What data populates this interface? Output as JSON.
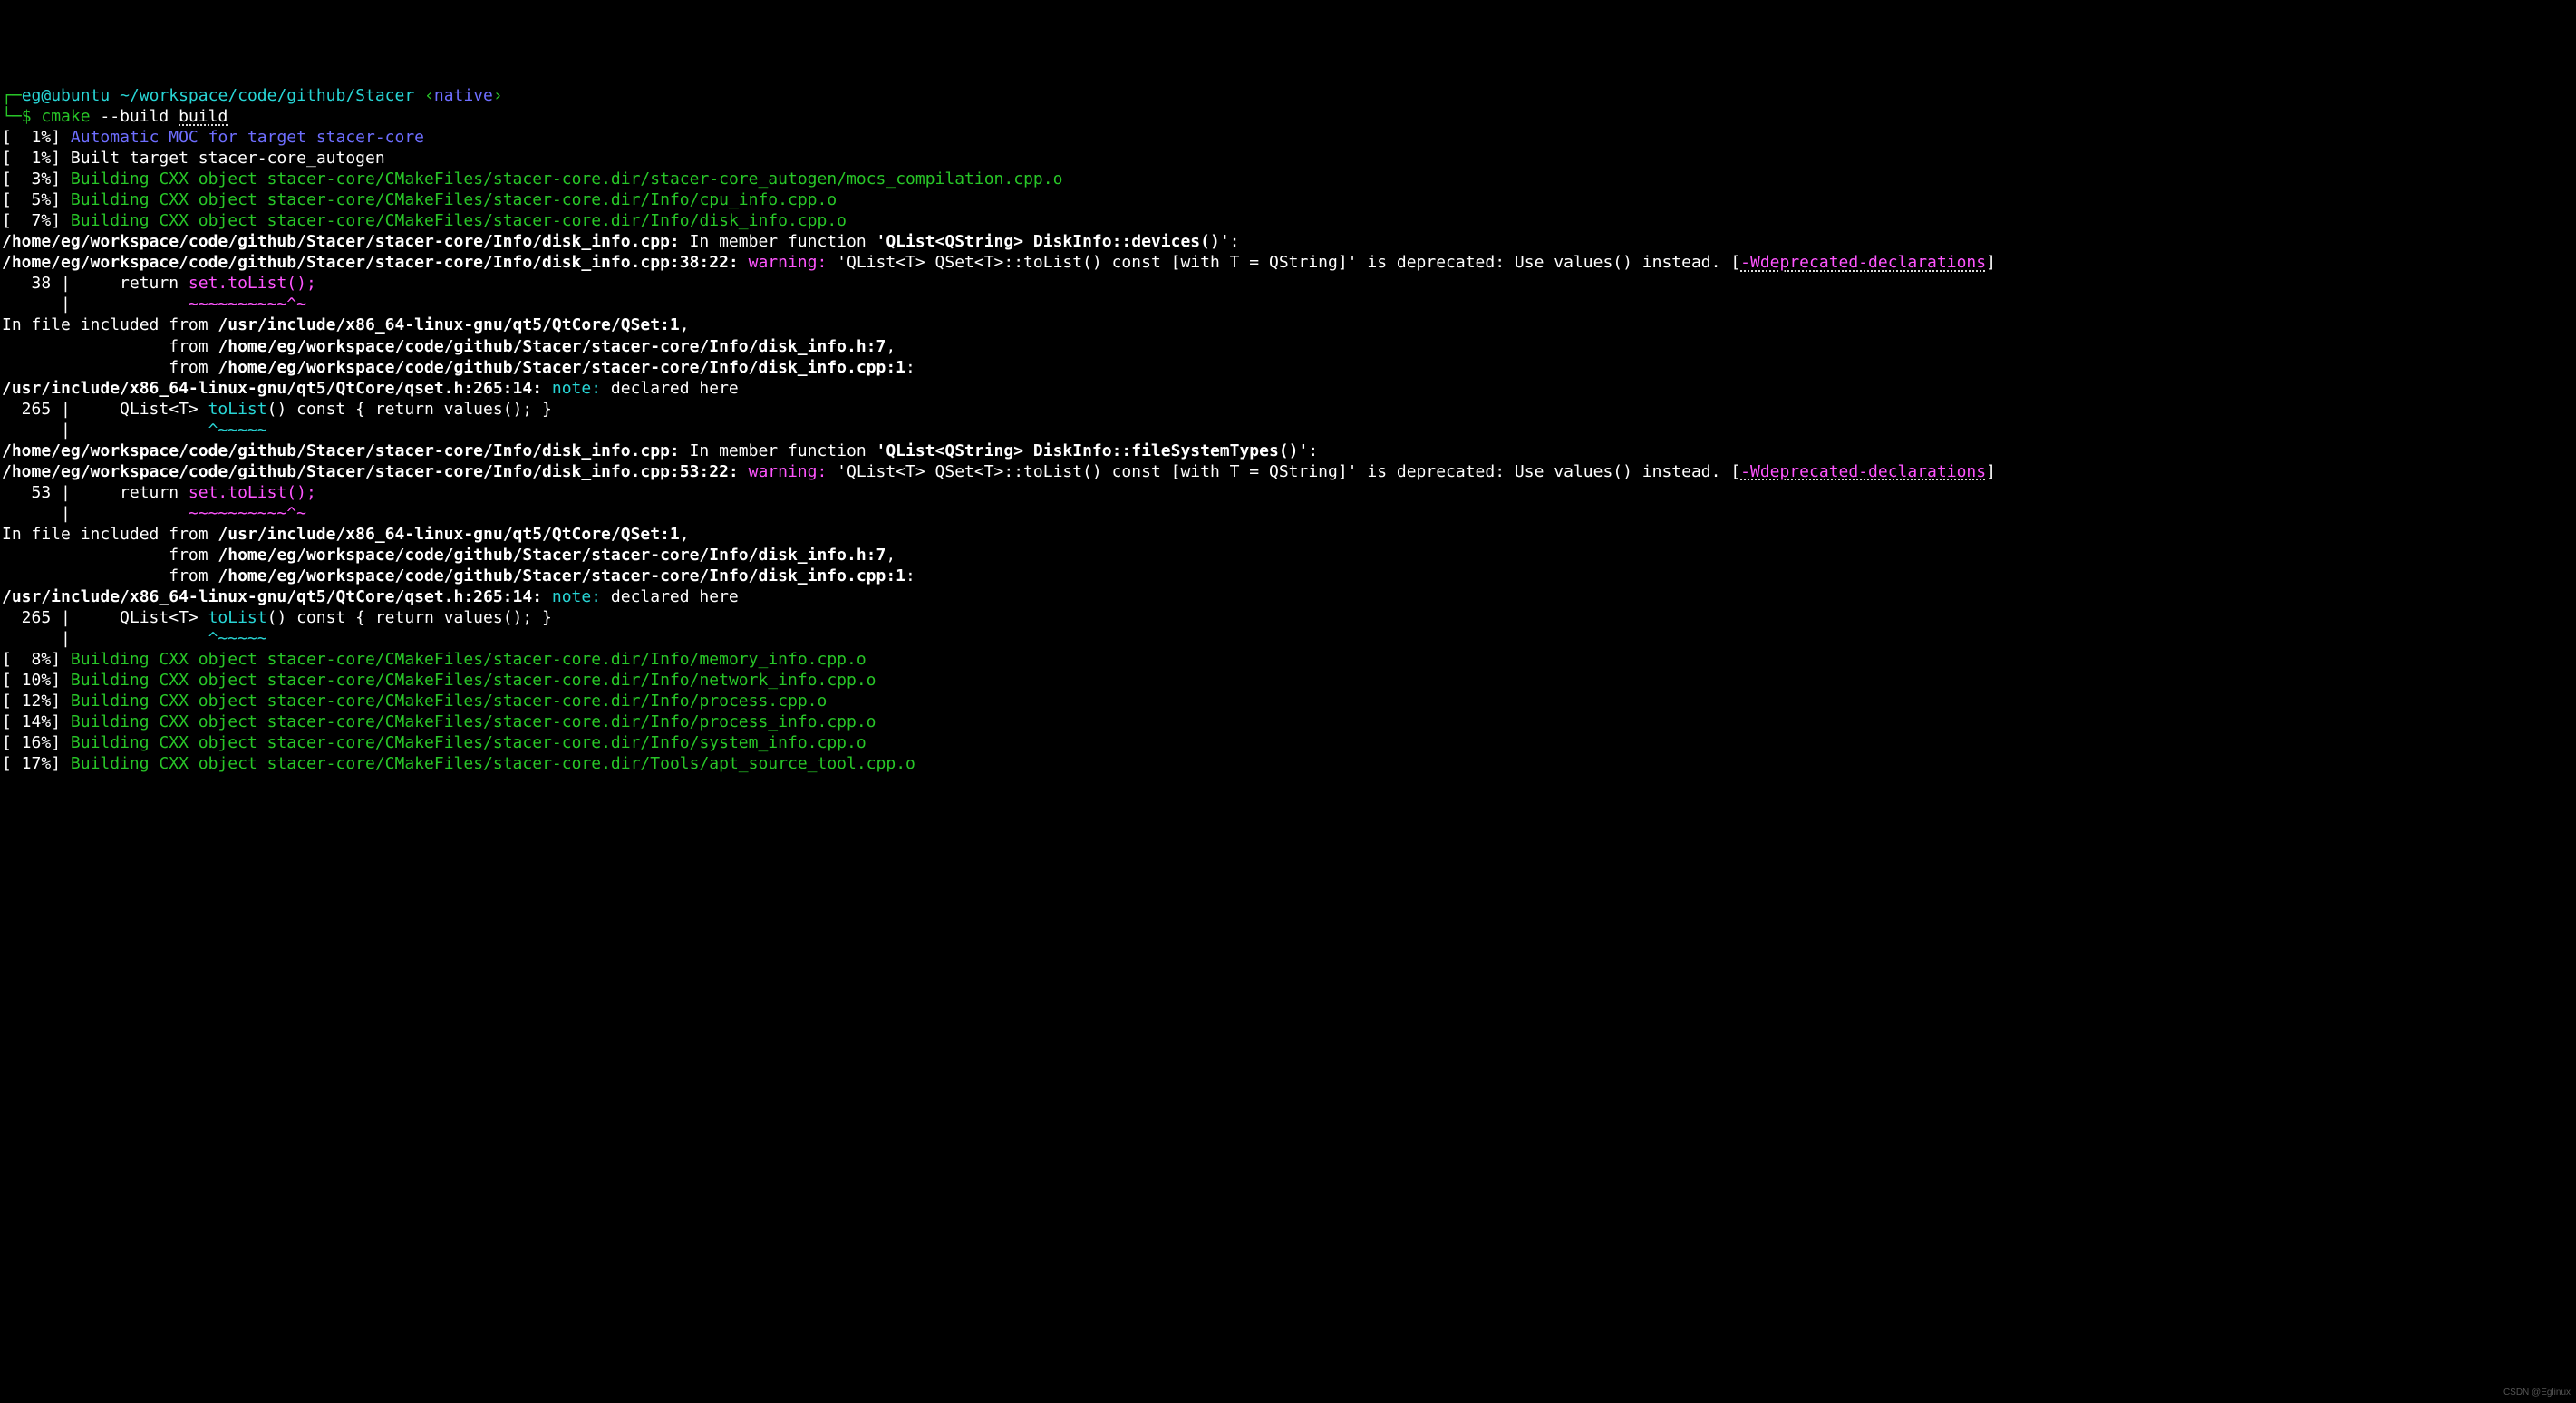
{
  "prompt": {
    "corner_tl": "┌─",
    "user": "eg@ubuntu",
    "path": "~/workspace/code/github/Stacer",
    "tag_open": "‹",
    "tag": "native",
    "tag_close": "›",
    "corner_bl": "└─",
    "dollar": "$",
    "cmd_bin": "cmake",
    "cmd_flag": "--build",
    "cmd_arg": "build"
  },
  "pct_open": "[",
  "pct_close": "]",
  "lines": {
    "l01": {
      "pct": "  1%",
      "automoc": "Automatic MOC for target stacer-core"
    },
    "l01b": {
      "pct": "  1%",
      "text": "Built target stacer-core_autogen"
    },
    "l03": {
      "pct": "  3%",
      "build": "Building CXX object stacer-core/CMakeFiles/stacer-core.dir/stacer-core_autogen/mocs_compilation.cpp.o"
    },
    "l05": {
      "pct": "  5%",
      "build": "Building CXX object stacer-core/CMakeFiles/stacer-core.dir/Info/cpu_info.cpp.o"
    },
    "l07": {
      "pct": "  7%",
      "build": "Building CXX object stacer-core/CMakeFiles/stacer-core.dir/Info/disk_info.cpp.o"
    },
    "l08": {
      "pct": "  8%",
      "build": "Building CXX object stacer-core/CMakeFiles/stacer-core.dir/Info/memory_info.cpp.o"
    },
    "l10": {
      "pct": " 10%",
      "build": "Building CXX object stacer-core/CMakeFiles/stacer-core.dir/Info/network_info.cpp.o"
    },
    "l12": {
      "pct": " 12%",
      "build": "Building CXX object stacer-core/CMakeFiles/stacer-core.dir/Info/process.cpp.o"
    },
    "l14": {
      "pct": " 14%",
      "build": "Building CXX object stacer-core/CMakeFiles/stacer-core.dir/Info/process_info.cpp.o"
    },
    "l16": {
      "pct": " 16%",
      "build": "Building CXX object stacer-core/CMakeFiles/stacer-core.dir/Info/system_info.cpp.o"
    },
    "l17": {
      "pct": " 17%",
      "build": "Building CXX object stacer-core/CMakeFiles/stacer-core.dir/Tools/apt_source_tool.cpp.o"
    }
  },
  "diag": {
    "file_hdr_1a": "/home/eg/workspace/code/github/Stacer/stacer-core/Info/disk_info.cpp:",
    "memfn_prefix": " In member function ",
    "memfn_devices": "'QList<QString> DiskInfo::devices()'",
    "memfn_fst": "'QList<QString> DiskInfo::fileSystemTypes()'",
    "colon": ":",
    "warn_loc_38": "/home/eg/workspace/code/github/Stacer/stacer-core/Info/disk_info.cpp:38:22:",
    "warn_loc_53": "/home/eg/workspace/code/github/Stacer/stacer-core/Info/disk_info.cpp:53:22:",
    "warn_label": " warning: ",
    "warn_msg_pre": "'QList<T> QSet<T>::toList() const [with T = QString]'",
    "warn_msg_tail": " is deprecated: Use values() instead. [",
    "warn_flag": "-Wdeprecated-declarations",
    "bracket_close": "]",
    "src_38_gutter": "   38 |",
    "src_53_gutter": "   53 |",
    "src_ret": "     return ",
    "src_set_tolist": "set.toList();",
    "caret_gutter": "      |",
    "caret_38": "            ~~~~~~~~~~^~",
    "inc_from": "In file included from ",
    "inc_qset": "/usr/include/x86_64-linux-gnu/qt5/QtCore/QSet:1",
    "inc_from_pad": "                 from ",
    "inc_disk_h": "/home/eg/workspace/code/github/Stacer/stacer-core/Info/disk_info.h:7",
    "inc_disk_cpp": "/home/eg/workspace/code/github/Stacer/stacer-core/Info/disk_info.cpp:1",
    "comma": ",",
    "colon2": ":",
    "note_loc": "/usr/include/x86_64-linux-gnu/qt5/QtCore/qset.h:265:14:",
    "note_label": " note: ",
    "note_msg": "declared here",
    "src_265_gutter": "  265 |",
    "src_265_a": "     QList<T> ",
    "src_265_b": "toList",
    "src_265_c": "() const { return values(); }",
    "caret_265": "              ^~~~~~"
  },
  "watermark": "CSDN @Eglinux"
}
